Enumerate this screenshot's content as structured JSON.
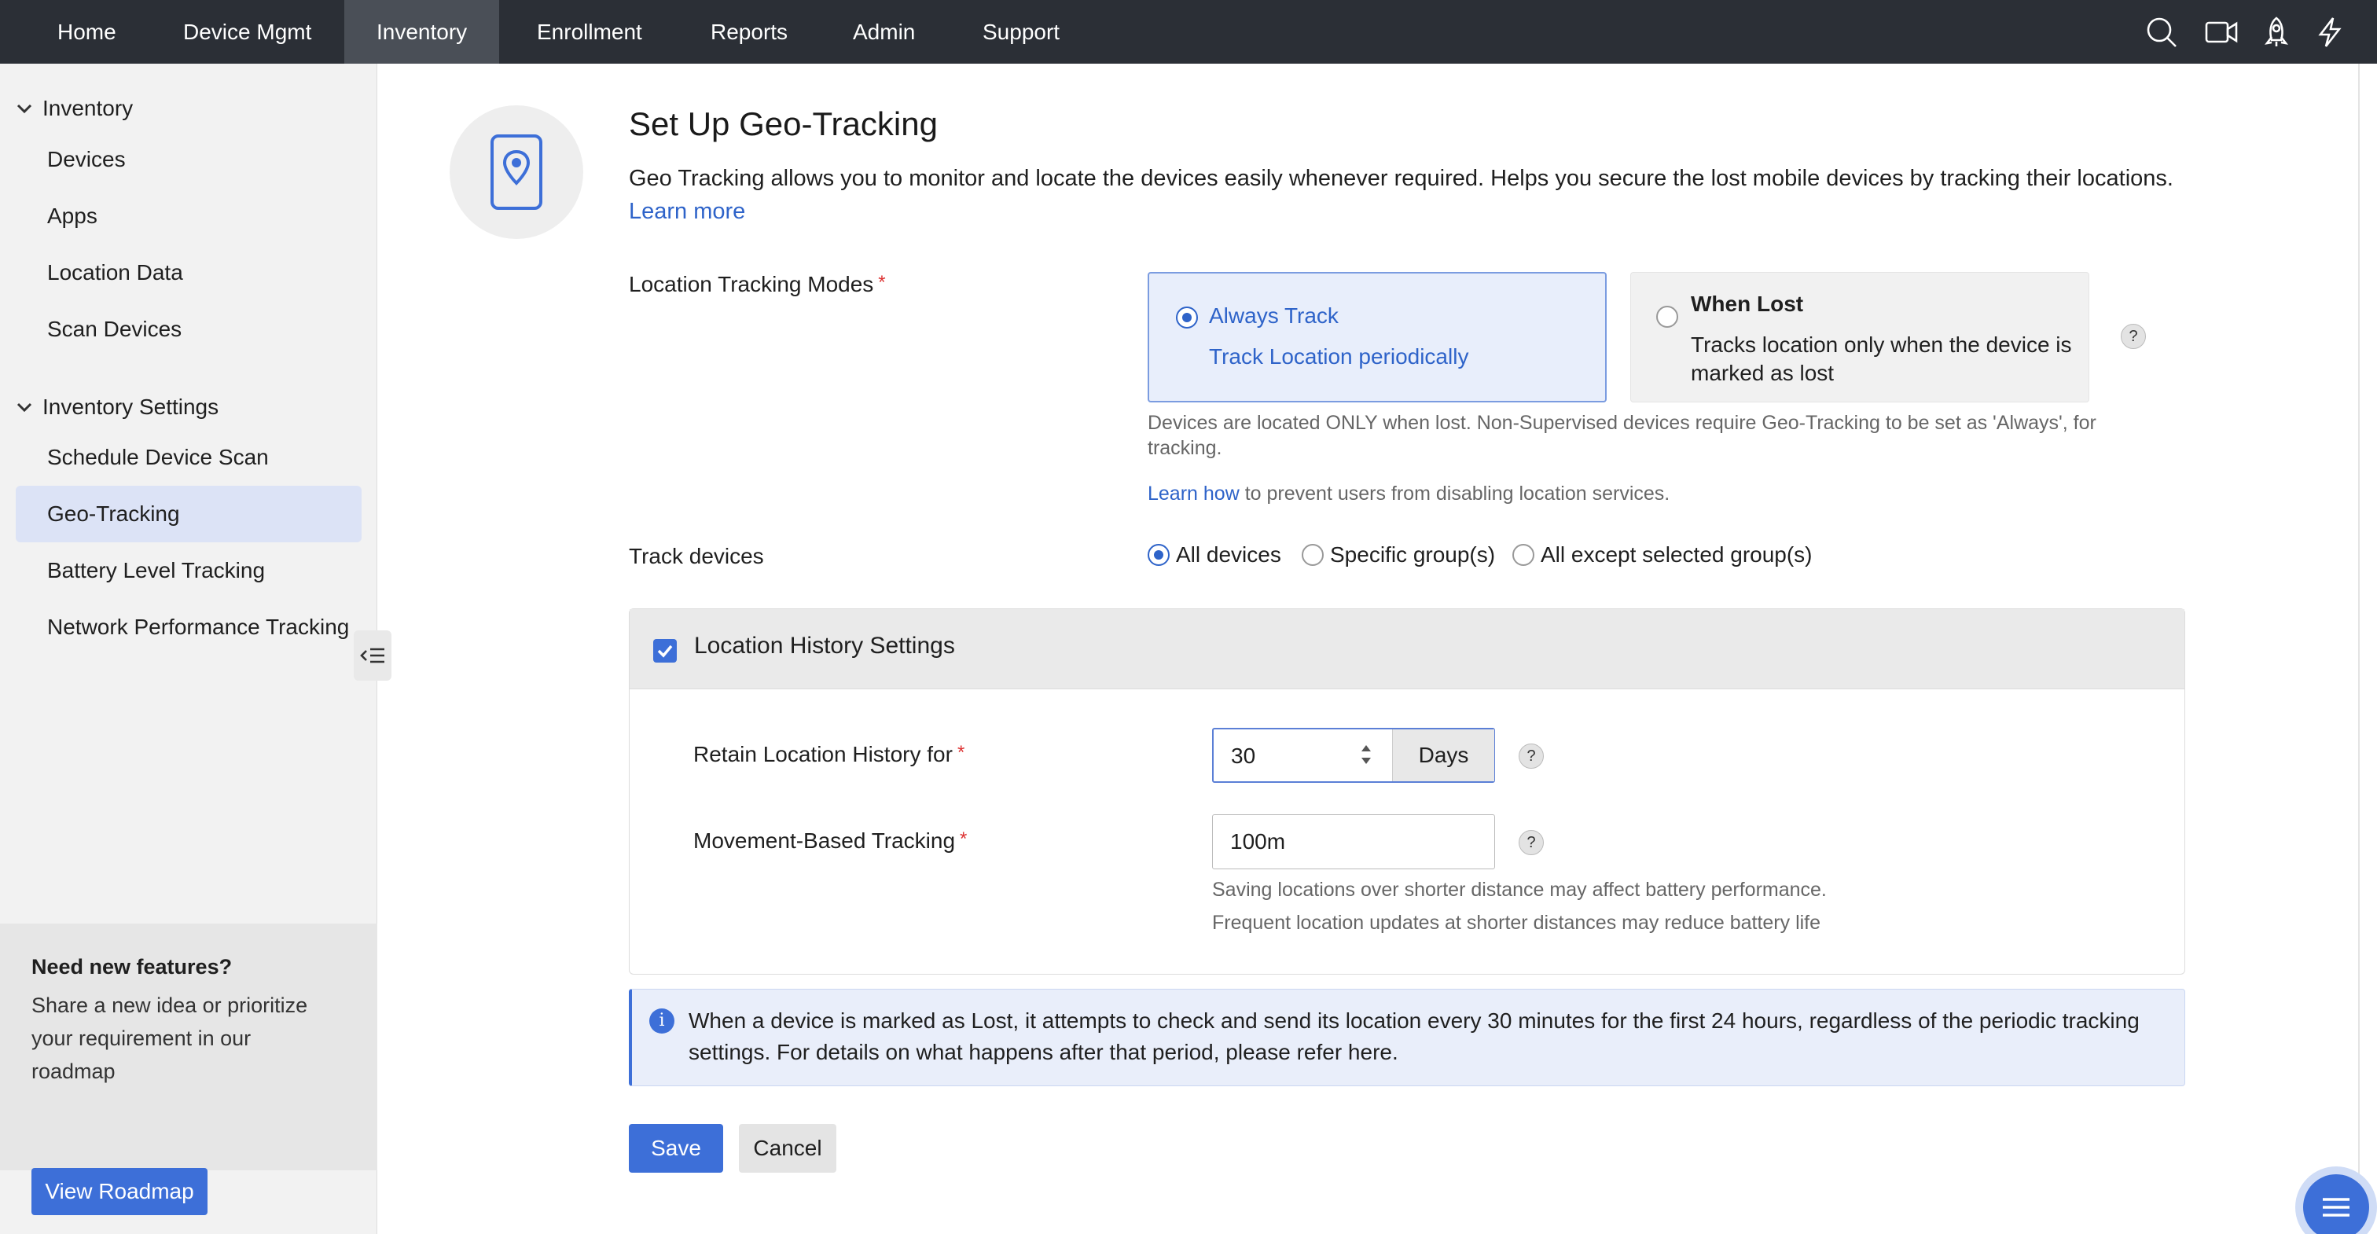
{
  "topnav": {
    "items": [
      "Home",
      "Device Mgmt",
      "Inventory",
      "Enrollment",
      "Reports",
      "Admin",
      "Support"
    ],
    "active": "Inventory",
    "icons": [
      "search-icon",
      "video-icon",
      "rocket-icon",
      "lightning-icon"
    ]
  },
  "sidebar": {
    "group1": "Inventory",
    "group1_items": [
      "Devices",
      "Apps",
      "Location Data",
      "Scan Devices"
    ],
    "group2": "Inventory Settings",
    "group2_items": [
      "Schedule Device Scan",
      "Geo-Tracking",
      "Battery Level Tracking",
      "Network Performance Tracking"
    ],
    "active": "Geo-Tracking",
    "feature_title": "Need new features?",
    "feature_desc": "Share a new idea or prioritize your requirement in our roadmap",
    "feature_button": "View Roadmap"
  },
  "page": {
    "title": "Set Up Geo-Tracking",
    "description": "Geo Tracking allows you to monitor and locate the devices easily whenever required. Helps you secure the lost mobile devices by tracking their locations.",
    "learn_more": "Learn more",
    "modes_label": "Location Tracking Modes",
    "mode_always_title": "Always Track",
    "mode_always_sub": "Track Location periodically",
    "mode_lost_title": "When Lost",
    "mode_lost_sub": "Tracks location only when the device is marked as lost",
    "mode_selected": "Always Track",
    "note_lost": "Devices are located ONLY when lost. Non-Supervised devices require Geo-Tracking to be set as 'Always', for tracking.",
    "learn_how": "Learn how",
    "learn_how_rest": "to prevent users from disabling location services.",
    "track_label": "Track devices",
    "track_options": [
      "All devices",
      "Specific group(s)",
      "All except selected group(s)"
    ],
    "track_selected": "All devices",
    "history_title": "Location History Settings",
    "history_checked": true,
    "retain_label": "Retain Location History for",
    "retain_value": "30",
    "retain_unit": "Days",
    "movement_label": "Movement-Based Tracking",
    "movement_value": "100m",
    "movement_note1": "Saving locations over shorter distance may affect battery performance.",
    "movement_note2": "Frequent location updates at shorter distances may reduce battery life",
    "info_text": "When a device is marked as Lost, it attempts to check and send its location every 30 minutes for the first 24 hours, regardless of the periodic tracking settings. For details on what happens after that period, please refer here.",
    "save": "Save",
    "cancel": "Cancel",
    "help_glyph": "?",
    "info_glyph": "i"
  },
  "colors": {
    "nav_bg": "#2b2f36",
    "accent": "#3d6fd8",
    "link": "#2e63c9",
    "sidebar_active": "#dce3f6"
  }
}
